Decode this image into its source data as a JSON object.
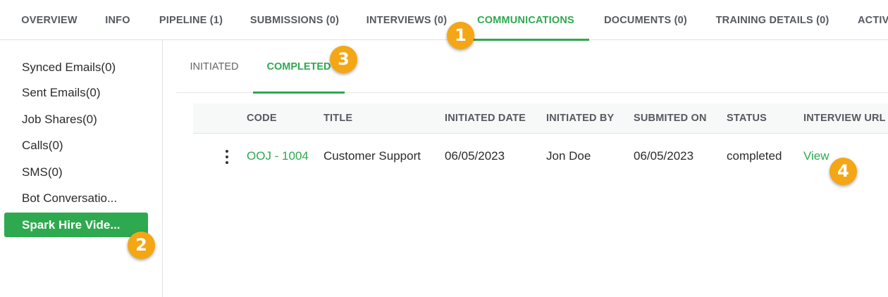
{
  "accent_color": "#2ea94f",
  "callout_color": "#f4a614",
  "top_tabs": [
    {
      "label": "OVERVIEW",
      "active": false
    },
    {
      "label": "INFO",
      "active": false
    },
    {
      "label": "PIPELINE (1)",
      "active": false
    },
    {
      "label": "SUBMISSIONS (0)",
      "active": false
    },
    {
      "label": "INTERVIEWS (0)",
      "active": false
    },
    {
      "label": "COMMUNICATIONS",
      "active": true
    },
    {
      "label": "DOCUMENTS (0)",
      "active": false
    },
    {
      "label": "TRAINING DETAILS (0)",
      "active": false
    },
    {
      "label": "ACTIV",
      "active": false
    }
  ],
  "sidebar": {
    "items": [
      {
        "label": "Synced Emails(0)"
      },
      {
        "label": "Sent Emails(0)"
      },
      {
        "label": "Job Shares(0)"
      },
      {
        "label": "Calls(0)"
      },
      {
        "label": "SMS(0)"
      },
      {
        "label": "Bot Conversatio..."
      },
      {
        "label": "Spark Hire Vide...",
        "active": true
      }
    ]
  },
  "sub_tabs": [
    {
      "label": "INITIATED",
      "active": false
    },
    {
      "label": "COMPLETED",
      "active": true
    }
  ],
  "table": {
    "columns": [
      "CODE",
      "TITLE",
      "INITIATED DATE",
      "INITIATED BY",
      "SUBMITED ON",
      "STATUS",
      "INTERVIEW URL"
    ],
    "rows": [
      {
        "code": "OOJ - 1004",
        "title": "Customer Support",
        "initiated_date": "06/05/2023",
        "initiated_by": "Jon Doe",
        "submitted_on": "06/05/2023",
        "status": "completed",
        "interview_url": "View"
      }
    ]
  },
  "callouts": [
    "1",
    "2",
    "3",
    "4"
  ]
}
